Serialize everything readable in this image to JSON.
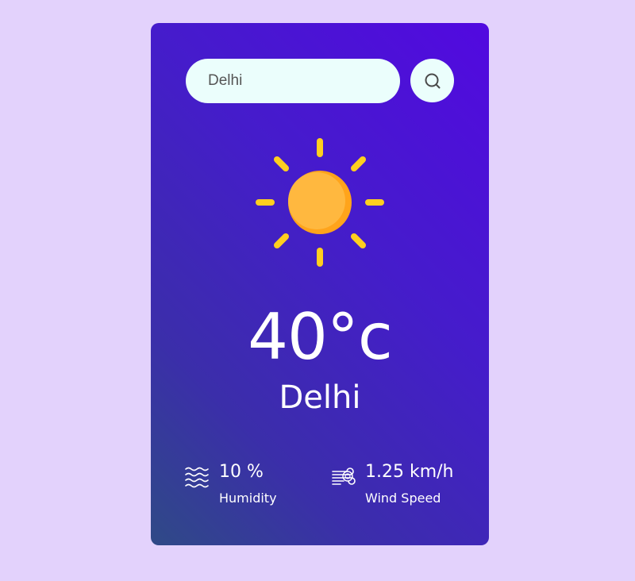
{
  "search": {
    "value": "Delhi",
    "placeholder": "",
    "button_icon": "search-icon"
  },
  "weather": {
    "icon": "sun-icon",
    "temperature": "40°c",
    "city": "Delhi"
  },
  "details": {
    "humidity": {
      "icon": "humidity-waves-icon",
      "value": "10 %",
      "label": "Humidity"
    },
    "wind": {
      "icon": "wind-icon",
      "value": "1.25 km/h",
      "label": "Wind Speed"
    }
  },
  "colors": {
    "page_background": "#e3d2fc",
    "card_gradient_start": "#5209e0",
    "card_gradient_end": "#2f4a86",
    "input_background": "#ebfefc",
    "sun_rays": "#ffcf1f",
    "sun_body": "#ffb13d",
    "text": "#ffffff"
  }
}
